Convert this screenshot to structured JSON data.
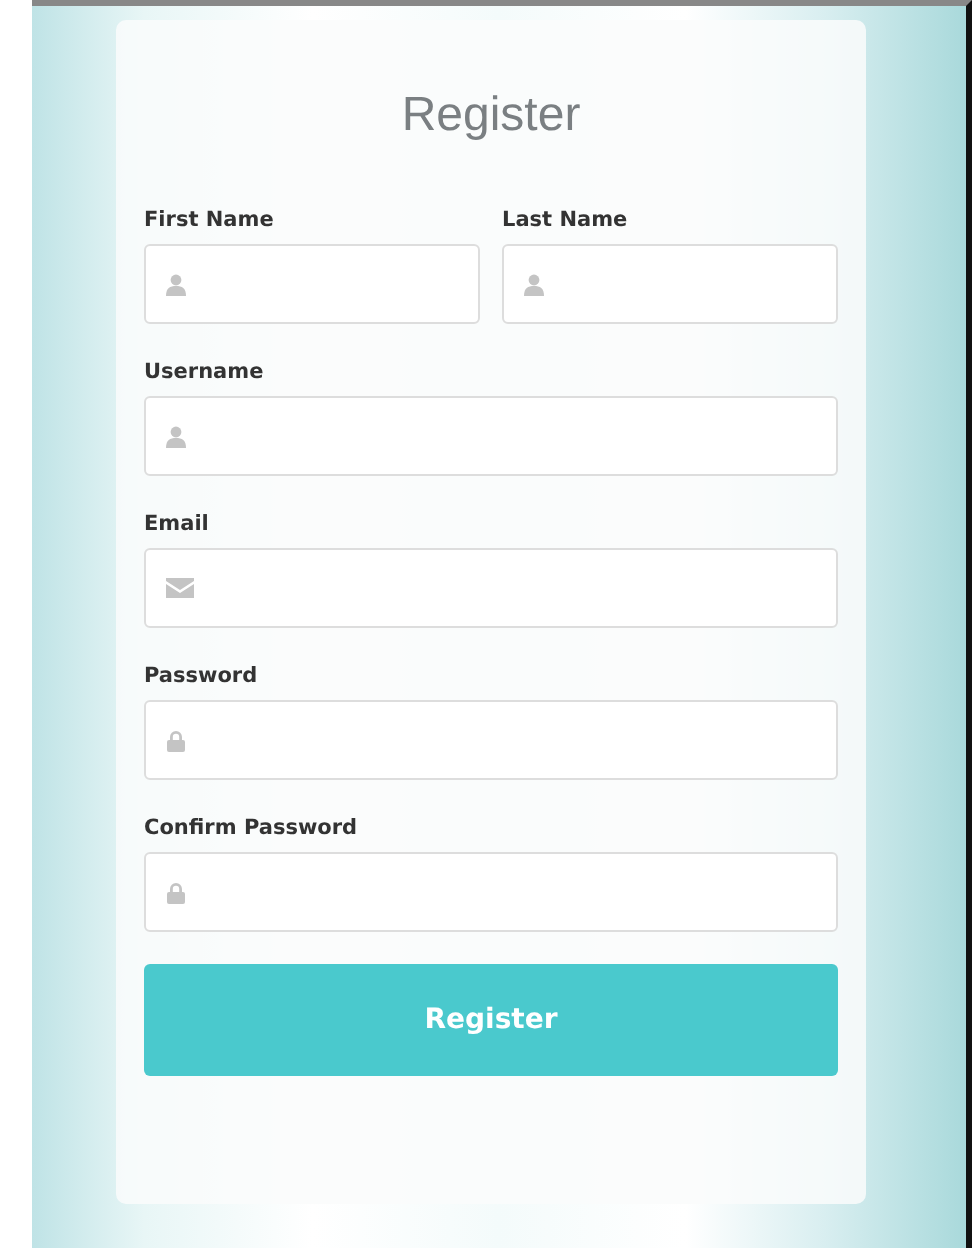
{
  "form": {
    "title": "Register",
    "rows": [
      [
        {
          "label": "First Name",
          "kind": "name"
        },
        {
          "label": "Last Name",
          "kind": "name"
        }
      ],
      [
        {
          "label": "Username",
          "kind": "name"
        }
      ],
      [
        {
          "label": "Email",
          "kind": "email"
        }
      ],
      [
        {
          "label": "Password",
          "kind": "password"
        }
      ],
      [
        {
          "label": "Confirm Password",
          "kind": "password"
        }
      ]
    ],
    "submit": "Register"
  }
}
